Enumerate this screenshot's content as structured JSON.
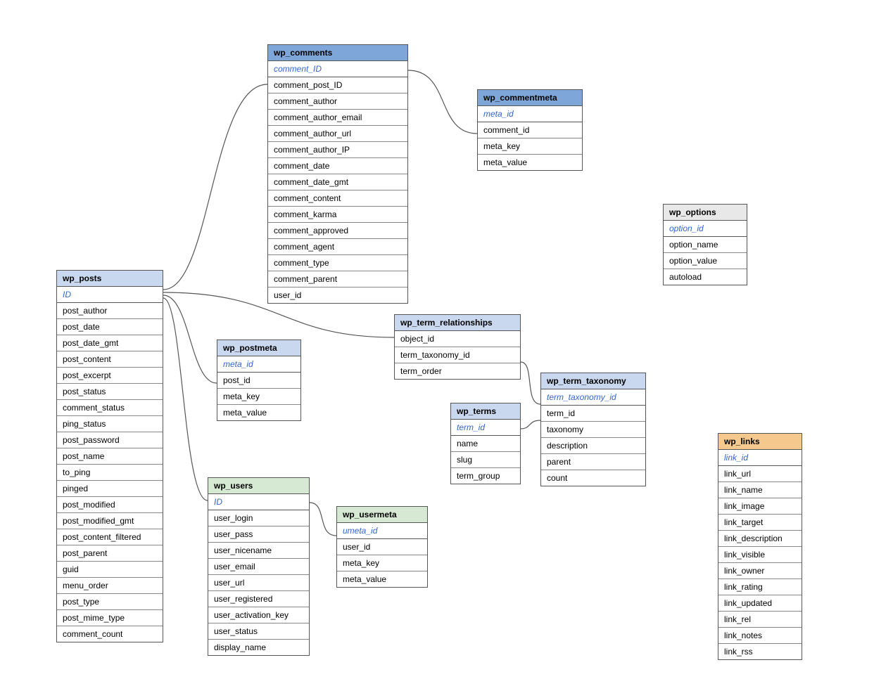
{
  "tables": {
    "wp_posts": {
      "title": "wp_posts",
      "pk": "ID",
      "fields": [
        "post_author",
        "post_date",
        "post_date_gmt",
        "post_content",
        "post_excerpt",
        "post_status",
        "comment_status",
        "ping_status",
        "post_password",
        "post_name",
        "to_ping",
        "pinged",
        "post_modified",
        "post_modified_gmt",
        "post_content_filtered",
        "post_parent",
        "guid",
        "menu_order",
        "post_type",
        "post_mime_type",
        "comment_count"
      ]
    },
    "wp_comments": {
      "title": "wp_comments",
      "pk": "comment_ID",
      "fields": [
        "comment_post_ID",
        "comment_author",
        "comment_author_email",
        "comment_author_url",
        "comment_author_IP",
        "comment_date",
        "comment_date_gmt",
        "comment_content",
        "comment_karma",
        "comment_approved",
        "comment_agent",
        "comment_type",
        "comment_parent",
        "user_id"
      ]
    },
    "wp_commentmeta": {
      "title": "wp_commentmeta",
      "pk": "meta_id",
      "fields": [
        "comment_id",
        "meta_key",
        "meta_value"
      ]
    },
    "wp_postmeta": {
      "title": "wp_postmeta",
      "pk": "meta_id",
      "fields": [
        "post_id",
        "meta_key",
        "meta_value"
      ]
    },
    "wp_term_relationships": {
      "title": "wp_term_relationships",
      "pk": null,
      "fields": [
        "object_id",
        "term_taxonomy_id",
        "term_order"
      ]
    },
    "wp_term_taxonomy": {
      "title": "wp_term_taxonomy",
      "pk": "term_taxonomy_id",
      "fields": [
        "term_id",
        "taxonomy",
        "description",
        "parent",
        "count"
      ]
    },
    "wp_terms": {
      "title": "wp_terms",
      "pk": "term_id",
      "fields": [
        "name",
        "slug",
        "term_group"
      ]
    },
    "wp_users": {
      "title": "wp_users",
      "pk": "ID",
      "fields": [
        "user_login",
        "user_pass",
        "user_nicename",
        "user_email",
        "user_url",
        "user_registered",
        "user_activation_key",
        "user_status",
        "display_name"
      ]
    },
    "wp_usermeta": {
      "title": "wp_usermeta",
      "pk": "umeta_id",
      "fields": [
        "user_id",
        "meta_key",
        "meta_value"
      ]
    },
    "wp_options": {
      "title": "wp_options",
      "pk": "option_id",
      "fields": [
        "option_name",
        "option_value",
        "autoload"
      ]
    },
    "wp_links": {
      "title": "wp_links",
      "pk": "link_id",
      "fields": [
        "link_url",
        "link_name",
        "link_image",
        "link_target",
        "link_description",
        "link_visible",
        "link_owner",
        "link_rating",
        "link_updated",
        "link_rel",
        "link_notes",
        "link_rss"
      ]
    }
  },
  "relationships": [
    {
      "from": "wp_posts",
      "to": "wp_comments",
      "type": "one-to-many"
    },
    {
      "from": "wp_posts",
      "to": "wp_postmeta",
      "type": "one-to-many"
    },
    {
      "from": "wp_posts",
      "to": "wp_term_relationships",
      "type": "one-to-many"
    },
    {
      "from": "wp_posts",
      "to": "wp_users",
      "type": "many-to-one"
    },
    {
      "from": "wp_comments",
      "to": "wp_commentmeta",
      "type": "one-to-many"
    },
    {
      "from": "wp_term_relationships",
      "to": "wp_term_taxonomy",
      "type": "many-to-one"
    },
    {
      "from": "wp_term_taxonomy",
      "to": "wp_terms",
      "type": "many-to-one"
    },
    {
      "from": "wp_users",
      "to": "wp_usermeta",
      "type": "one-to-many"
    }
  ]
}
